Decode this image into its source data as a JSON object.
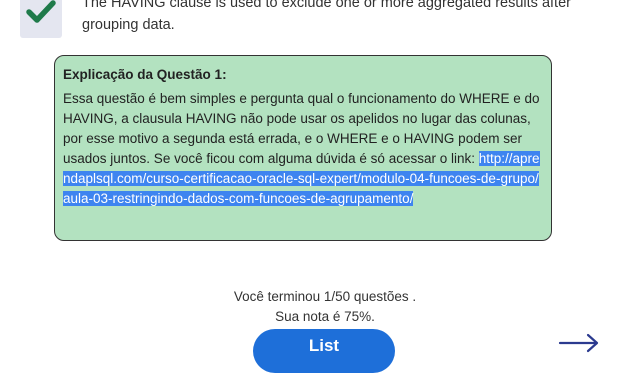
{
  "answer": {
    "text": "The HAVING clause is used to exclude one or more aggregated results after grouping data.",
    "check_icon": "check-icon",
    "accent_color": "#1f7a4a"
  },
  "explanation": {
    "title": "Explicação da Questão 1:",
    "body": "Essa questão é bem simples e pergunta qual o funcionamento do WHERE e do HAVING, a clausula HAVING não pode usar os apelidos no lugar das colunas, por esse motivo a segunda está errada, e o WHERE e o HAVING podem ser usados juntos. Se você ficou com alguma dúvida é só acessar o link:",
    "link": "http://aprendaplsql.com/curso-certificacao-oracle-sql-expert/modulo-04-funcoes-de-grupo/aula-03-restringindo-dados-com-funcoes-de-agrupamento/",
    "background_color": "#b3e2c0",
    "link_highlight_color": "#3e84f0"
  },
  "result": {
    "finished_text": "Você terminou 1/50 questões .",
    "score_text": "Sua nota é 75%."
  },
  "buttons": {
    "list_label": "List",
    "list_color": "#1e6fd9",
    "next_icon": "arrow-right-icon"
  }
}
